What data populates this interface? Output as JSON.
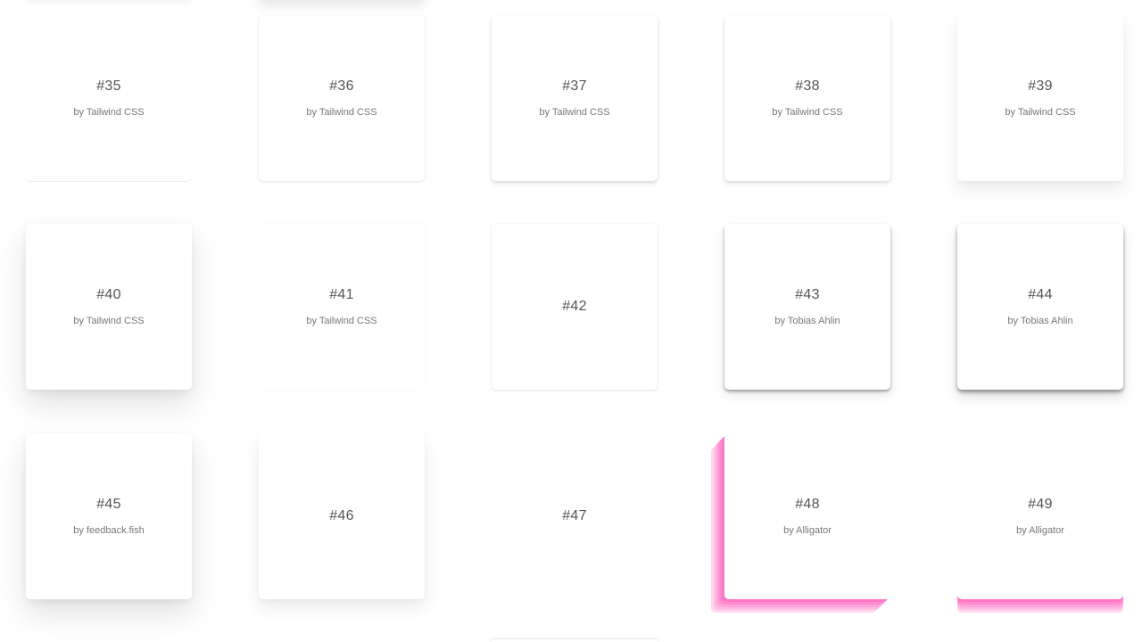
{
  "cards": [
    {
      "number": "#35",
      "author": "by Tailwind CSS"
    },
    {
      "number": "#36",
      "author": "by Tailwind CSS"
    },
    {
      "number": "#37",
      "author": "by Tailwind CSS"
    },
    {
      "number": "#38",
      "author": "by Tailwind CSS"
    },
    {
      "number": "#39",
      "author": "by Tailwind CSS"
    },
    {
      "number": "#40",
      "author": "by Tailwind CSS"
    },
    {
      "number": "#41",
      "author": "by Tailwind CSS"
    },
    {
      "number": "#42",
      "author": ""
    },
    {
      "number": "#43",
      "author": "by Tobias Ahlin"
    },
    {
      "number": "#44",
      "author": "by Tobias Ahlin"
    },
    {
      "number": "#45",
      "author": "by feedback.fish"
    },
    {
      "number": "#46",
      "author": ""
    },
    {
      "number": "#47",
      "author": ""
    },
    {
      "number": "#48",
      "author": "by Alligator"
    },
    {
      "number": "#49",
      "author": "by Alligator"
    }
  ],
  "colors": {
    "background": "#ffffff",
    "card": "#ffffff",
    "number_text": "#555555",
    "author_text": "#777777",
    "pink_accent": "#ff77c6"
  }
}
